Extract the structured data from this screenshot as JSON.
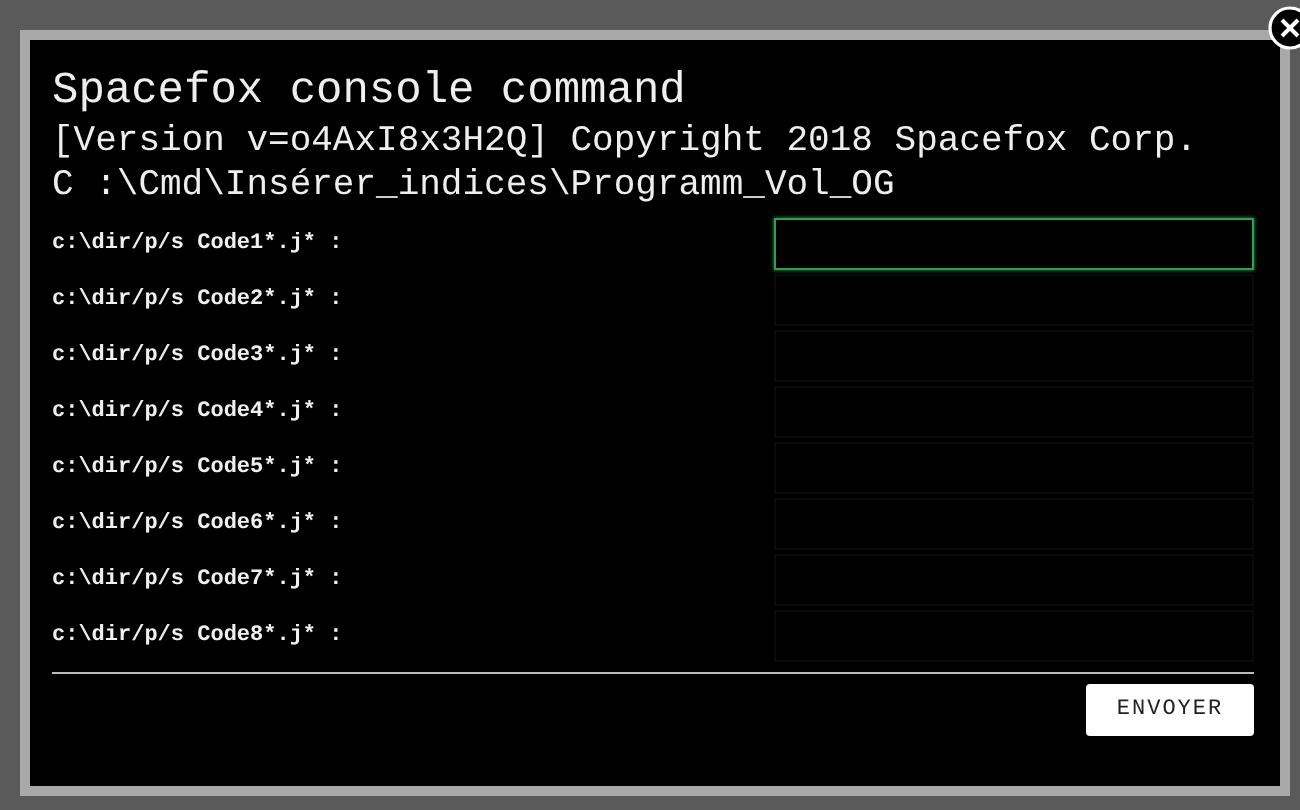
{
  "console": {
    "title": "Spacefox console command",
    "version_line": "[Version v=o4AxI8x3H2Q] Copyright 2018 Spacefox Corp.",
    "path_line": "C :\\Cmd\\Insérer_indices\\Programm_Vol_OG"
  },
  "fields": [
    {
      "label": "c:\\dir/p/s Code1*.j* :",
      "focused": true
    },
    {
      "label": "c:\\dir/p/s Code2*.j* :",
      "focused": false
    },
    {
      "label": "c:\\dir/p/s Code3*.j* :",
      "focused": false
    },
    {
      "label": "c:\\dir/p/s Code4*.j* :",
      "focused": false
    },
    {
      "label": "c:\\dir/p/s Code5*.j* :",
      "focused": false
    },
    {
      "label": "c:\\dir/p/s Code6*.j* :",
      "focused": false
    },
    {
      "label": "c:\\dir/p/s Code7*.j* :",
      "focused": false
    },
    {
      "label": "c:\\dir/p/s Code8*.j* :",
      "focused": false
    }
  ],
  "buttons": [
    "ENVOYER"
  ]
}
